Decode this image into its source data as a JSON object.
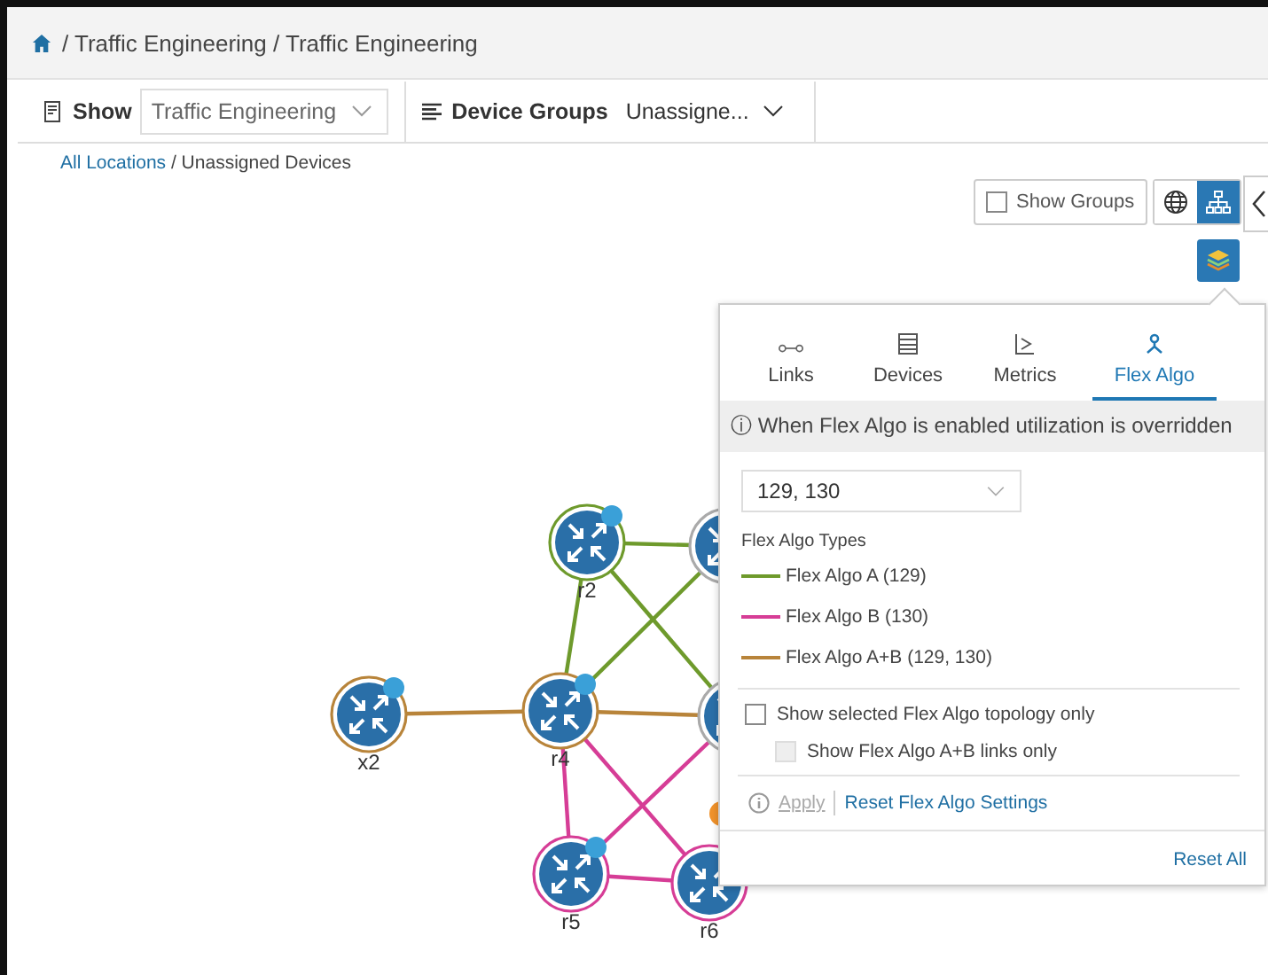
{
  "breadcrumb": {
    "home": true,
    "path": "/ Traffic Engineering / Traffic Engineering"
  },
  "toolbar": {
    "show_label": "Show",
    "show_value": "Traffic Engineering",
    "groups_label": "Device Groups",
    "groups_value": "Unassigne..."
  },
  "location": {
    "link": "All Locations",
    "current": "/ Unassigned Devices"
  },
  "view_controls": {
    "show_groups": {
      "label": "Show Groups",
      "checked": false
    },
    "views": [
      {
        "kind": "globe",
        "selected": false
      },
      {
        "kind": "topology",
        "selected": true
      }
    ]
  },
  "topology": {
    "nodes": [
      {
        "kind": "router",
        "label": "r2",
        "color": "#6e9a2c"
      },
      {
        "kind": "router"
      },
      {
        "kind": "router",
        "label": "x2",
        "color": "#b8843a"
      },
      {
        "kind": "router",
        "label": "r4",
        "color": "#b8843a"
      },
      {
        "kind": "router"
      },
      {
        "kind": "router",
        "label": "r5",
        "color": "#d63d96"
      },
      {
        "kind": "router",
        "label": "r6",
        "color": "#d63d96"
      }
    ],
    "links": [
      {
        "color": "#6e9a2c"
      },
      {
        "color": "#6e9a2c"
      },
      {
        "color": "#6e9a2c"
      },
      {
        "color": "#6e9a2c"
      },
      {
        "color": "#b8843a"
      },
      {
        "color": "#b8843a"
      },
      {
        "color": "#d63d96"
      },
      {
        "color": "#d63d96"
      },
      {
        "color": "#d63d96"
      },
      {
        "color": "#d63d96"
      }
    ]
  },
  "panel": {
    "tabs": [
      {
        "label": "Links",
        "kind": "links",
        "selected": false
      },
      {
        "label": "Devices",
        "kind": "devices",
        "selected": false
      },
      {
        "label": "Metrics",
        "kind": "metrics",
        "selected": false
      },
      {
        "label": "Flex Algo",
        "kind": "flex",
        "selected": true
      }
    ],
    "notice": "ⓘ When Flex Algo is enabled utilization is overridden",
    "select_value": "129, 130",
    "legend_title": "Flex Algo Types",
    "legend": [
      {
        "label": "Flex Algo A (129)",
        "color": "#6e9a2c"
      },
      {
        "label": "Flex Algo B (130)",
        "color": "#d63d96"
      },
      {
        "label": "Flex Algo A+B (129, 130)",
        "color": "#b8843a"
      }
    ],
    "options": [
      {
        "label": "Show selected Flex Algo topology only",
        "checked": false,
        "disabled": false,
        "nested": false
      },
      {
        "label": "Show Flex Algo A+B links only",
        "checked": false,
        "disabled": true,
        "nested": true
      }
    ],
    "apply": {
      "label": "Apply",
      "disabled": true
    },
    "reset_settings": "Reset Flex Algo Settings",
    "reset_all": "Reset All"
  }
}
